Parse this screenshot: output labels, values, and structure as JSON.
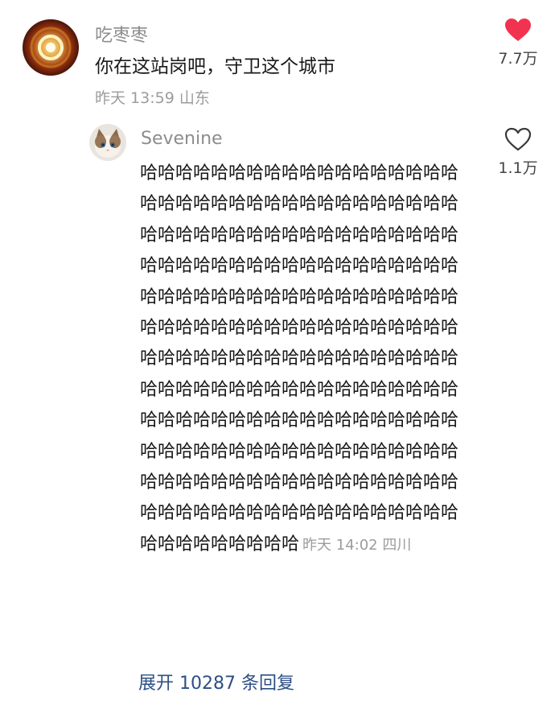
{
  "comment": {
    "author": "吃枣枣",
    "text": "你在这站岗吧，守卫这个城市",
    "meta": "昨天 13:59 山东",
    "likes": "7.7万",
    "liked": true
  },
  "reply": {
    "author": "Sevenine",
    "text": "哈哈哈哈哈哈哈哈哈哈哈哈哈哈哈哈哈哈哈哈哈哈哈哈哈哈哈哈哈哈哈哈哈哈哈哈哈哈哈哈哈哈哈哈哈哈哈哈哈哈哈哈哈哈哈哈哈哈哈哈哈哈哈哈哈哈哈哈哈哈哈哈哈哈哈哈哈哈哈哈哈哈哈哈哈哈哈哈哈哈哈哈哈哈哈哈哈哈哈哈哈哈哈哈哈哈哈哈哈哈哈哈哈哈哈哈哈哈哈哈哈哈哈哈哈哈哈哈哈哈哈哈哈哈哈哈哈哈哈哈哈哈哈哈哈哈哈哈哈哈哈哈哈哈哈哈哈哈哈哈哈哈哈哈哈哈哈哈哈哈哈哈哈哈哈哈哈哈哈哈哈哈哈哈哈哈哈哈哈哈哈哈哈哈哈哈哈哈哈哈哈哈哈哈哈哈哈哈哈哈哈哈哈哈哈哈哈哈哈哈哈哈哈哈哈",
    "meta": "昨天 14:02 四川",
    "likes": "1.1万",
    "liked": false
  },
  "expand": {
    "prefix": "展开",
    "count": "10287",
    "suffix": "条回复"
  },
  "colors": {
    "like_active": "#f2334f",
    "link": "#2d4f86"
  }
}
